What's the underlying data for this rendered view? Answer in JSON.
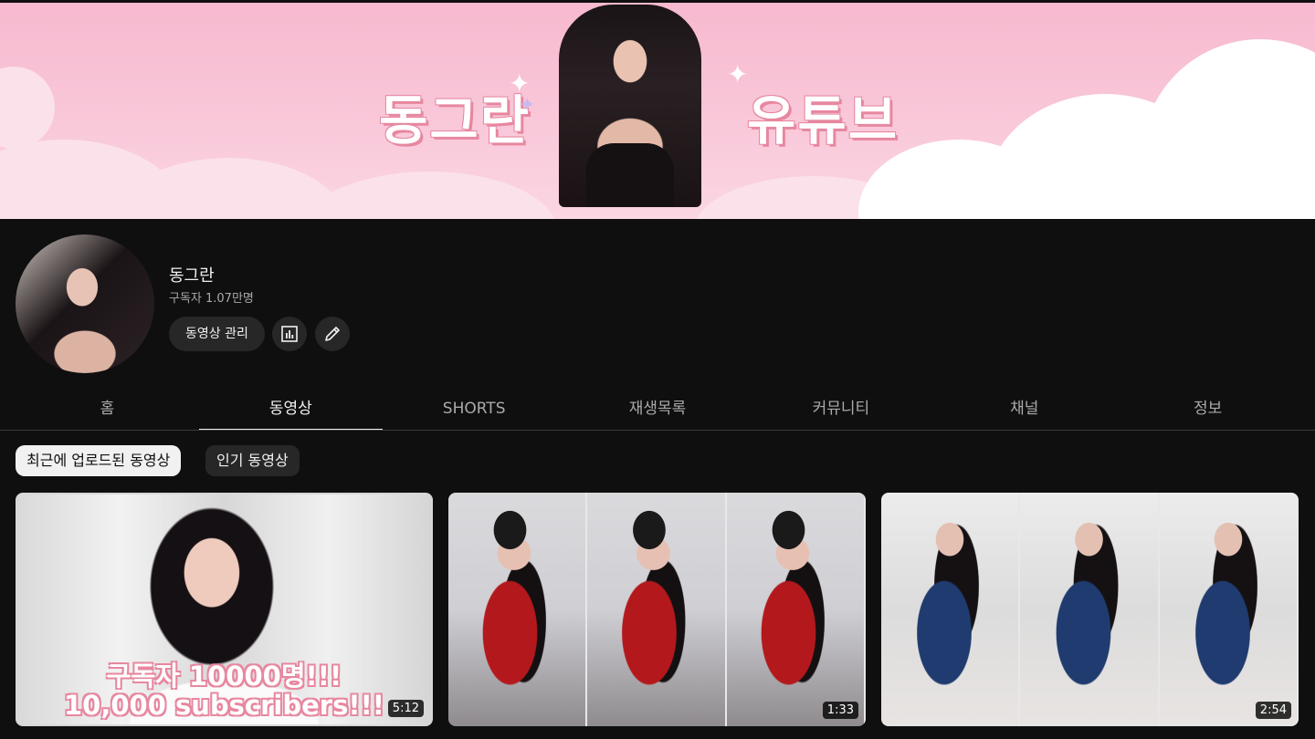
{
  "banner": {
    "left_text": "동그란",
    "right_text": "유튜브"
  },
  "channel": {
    "name": "동그란",
    "subscribers": "구독자 1.07만명",
    "manage_button": "동영상 관리",
    "stats_icon": "analytics-icon",
    "edit_icon": "pencil-icon"
  },
  "tabs": [
    {
      "label": "홈",
      "active": false
    },
    {
      "label": "동영상",
      "active": true
    },
    {
      "label": "SHORTS",
      "active": false
    },
    {
      "label": "재생목록",
      "active": false
    },
    {
      "label": "커뮤니티",
      "active": false
    },
    {
      "label": "채널",
      "active": false
    },
    {
      "label": "정보",
      "active": false
    }
  ],
  "filters": [
    {
      "label": "최근에 업로드된 동영상",
      "selected": true
    },
    {
      "label": "인기 동영상",
      "selected": false
    }
  ],
  "videos": [
    {
      "overlay_line1": "구독자 10000명!!!",
      "overlay_line2": "10,000 subscribers!!!",
      "duration": "5:12"
    },
    {
      "duration": "1:33"
    },
    {
      "duration": "2:54"
    }
  ]
}
